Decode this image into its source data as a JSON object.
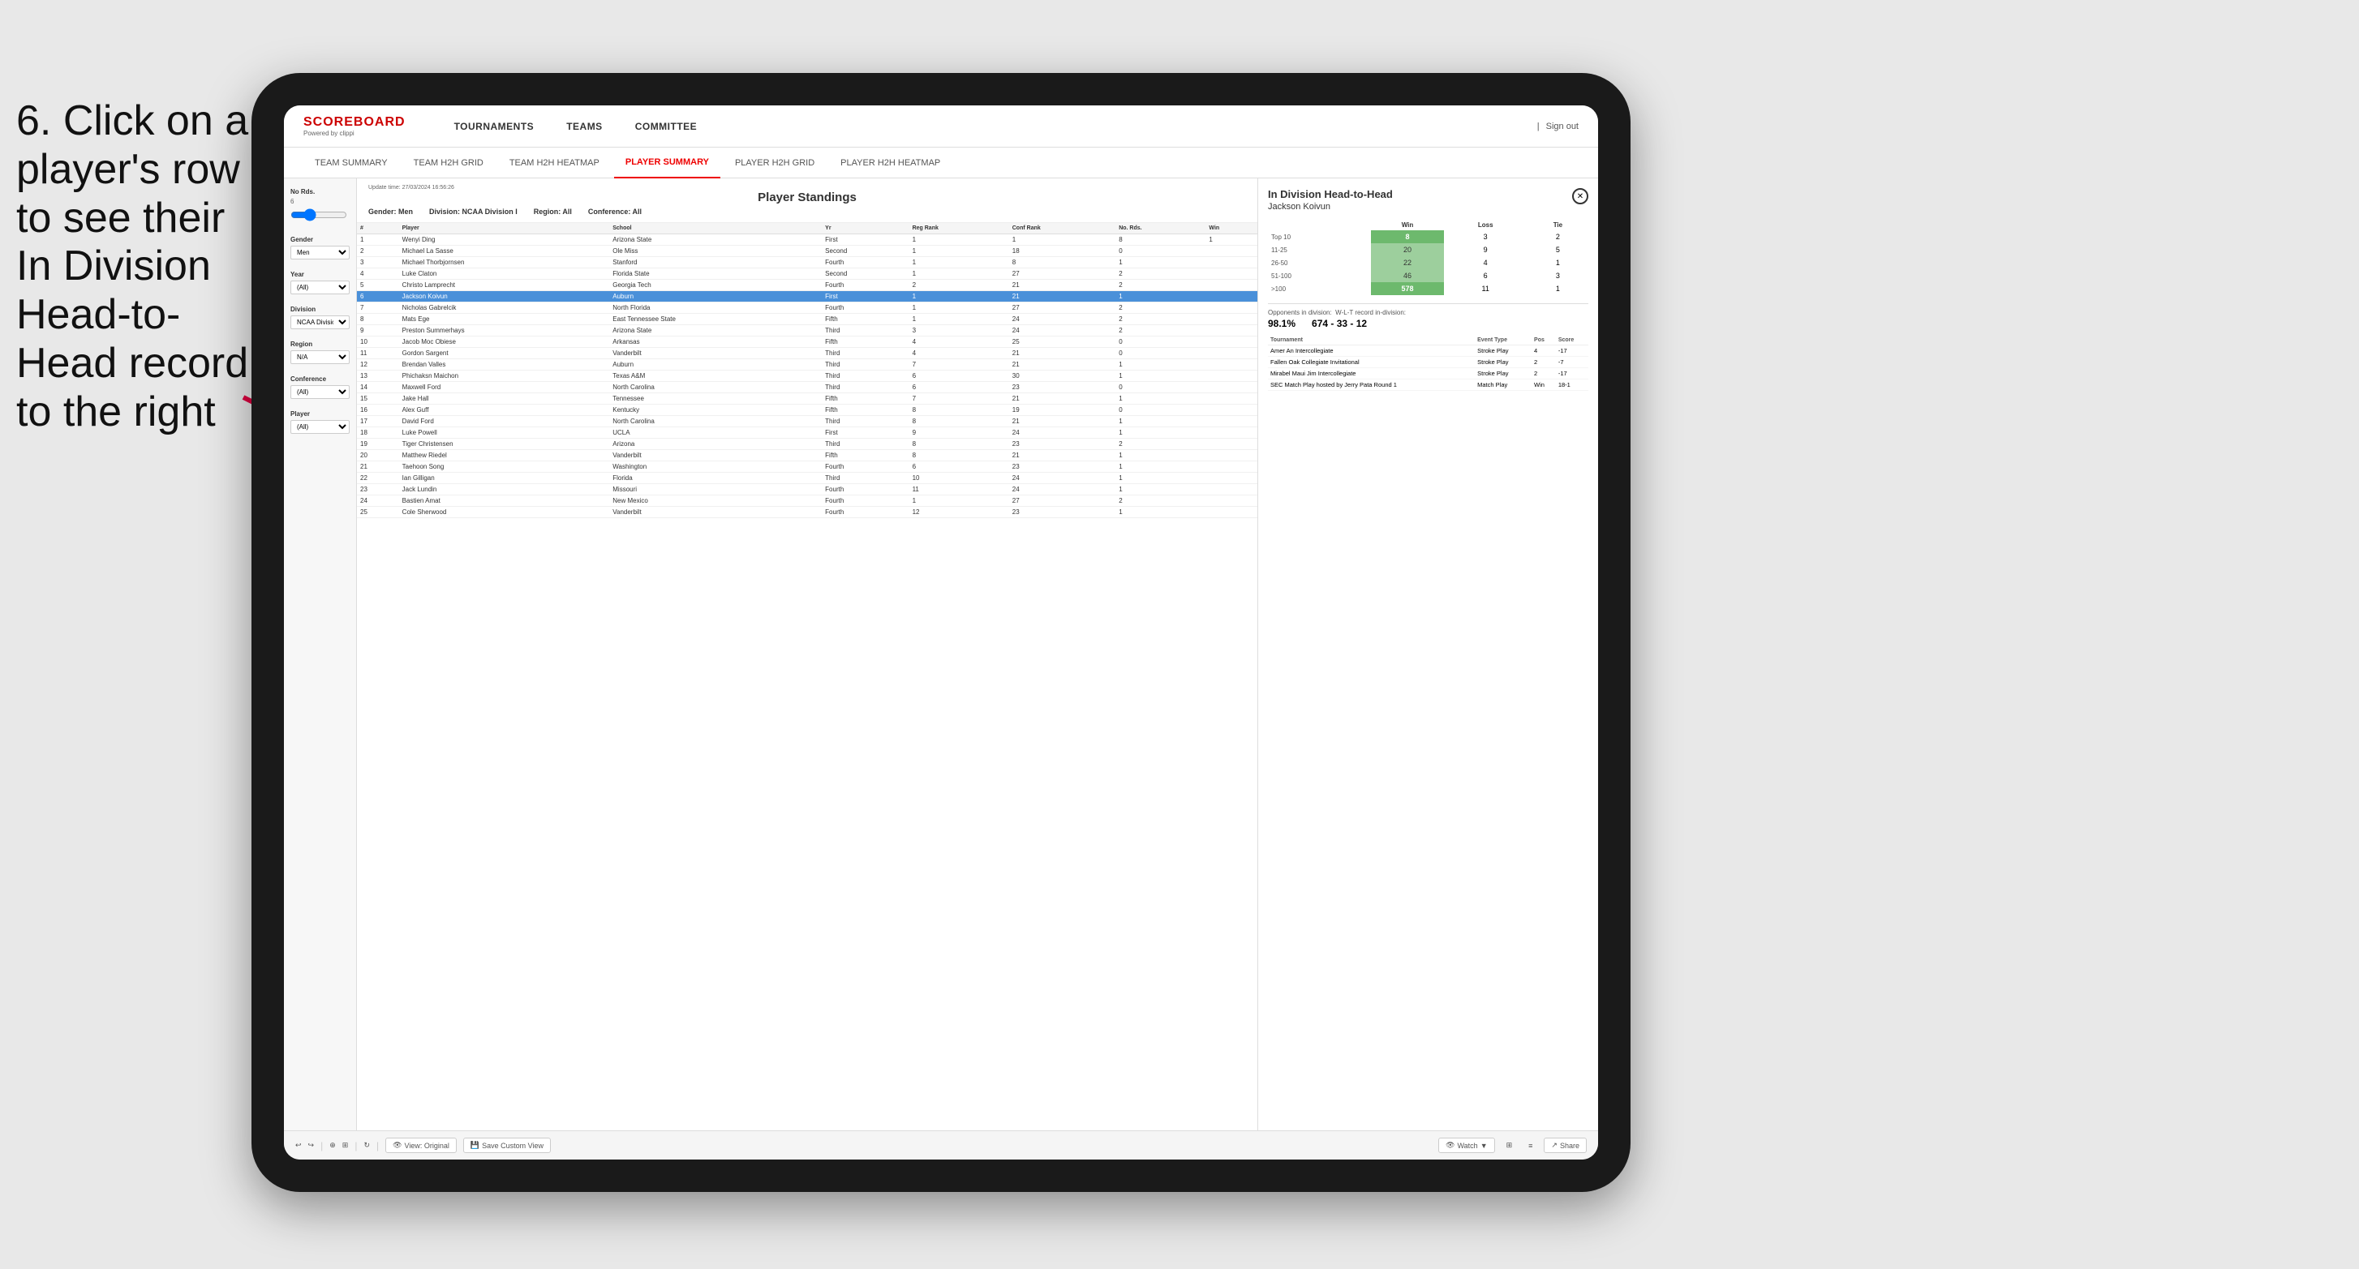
{
  "instruction": {
    "text": "6. Click on a player's row to see their In Division Head-to-Head record to the right"
  },
  "nav": {
    "logo": "SCOREBOARD",
    "logo_sub": "Powered by clippi",
    "items": [
      "TOURNAMENTS",
      "TEAMS",
      "COMMITTEE"
    ],
    "sign_out": "Sign out"
  },
  "sub_nav": {
    "items": [
      "TEAM SUMMARY",
      "TEAM H2H GRID",
      "TEAM H2H HEATMAP",
      "PLAYER SUMMARY",
      "PLAYER H2H GRID",
      "PLAYER H2H HEATMAP"
    ],
    "active": "PLAYER SUMMARY"
  },
  "table": {
    "title": "Player Standings",
    "update_time": "Update time:",
    "update_date": "27/03/2024 16:56:26",
    "filters": {
      "gender": "Gender: Men",
      "division": "Division: NCAA Division I",
      "region": "Region: All",
      "conference": "Conference: All"
    },
    "columns": [
      "#",
      "Player",
      "School",
      "Yr",
      "Reg Rank",
      "Conf Rank",
      "No. Rds.",
      "Win"
    ],
    "rows": [
      {
        "num": 1,
        "player": "Wenyi Ding",
        "school": "Arizona State",
        "yr": "First",
        "reg": 1,
        "conf": 1,
        "rds": 8,
        "win": 1
      },
      {
        "num": 2,
        "player": "Michael La Sasse",
        "school": "Ole Miss",
        "yr": "Second",
        "reg": 1,
        "conf": 18,
        "rds": 0
      },
      {
        "num": 3,
        "player": "Michael Thorbjornsen",
        "school": "Stanford",
        "yr": "Fourth",
        "reg": 1,
        "conf": 8,
        "rds": 1
      },
      {
        "num": 4,
        "player": "Luke Claton",
        "school": "Florida State",
        "yr": "Second",
        "reg": 1,
        "conf": 27,
        "rds": 2
      },
      {
        "num": 5,
        "player": "Christo Lamprecht",
        "school": "Georgia Tech",
        "yr": "Fourth",
        "reg": 2,
        "conf": 21,
        "rds": 2
      },
      {
        "num": 6,
        "player": "Jackson Koivun",
        "school": "Auburn",
        "yr": "First",
        "reg": 1,
        "conf": 21,
        "rds": 1,
        "highlighted": true
      },
      {
        "num": 7,
        "player": "Nicholas Gabrelcik",
        "school": "North Florida",
        "yr": "Fourth",
        "reg": 1,
        "conf": 27,
        "rds": 2
      },
      {
        "num": 8,
        "player": "Mats Ege",
        "school": "East Tennessee State",
        "yr": "Fifth",
        "reg": 1,
        "conf": 24,
        "rds": 2
      },
      {
        "num": 9,
        "player": "Preston Summerhays",
        "school": "Arizona State",
        "yr": "Third",
        "reg": 3,
        "conf": 24,
        "rds": 2
      },
      {
        "num": 10,
        "player": "Jacob Moc Obiese",
        "school": "Arkansas",
        "yr": "Fifth",
        "reg": 4,
        "conf": 25,
        "rds": 0
      },
      {
        "num": 11,
        "player": "Gordon Sargent",
        "school": "Vanderbilt",
        "yr": "Third",
        "reg": 4,
        "conf": 21,
        "rds": 0
      },
      {
        "num": 12,
        "player": "Brendan Valles",
        "school": "Auburn",
        "yr": "Third",
        "reg": 7,
        "conf": 21,
        "rds": 1
      },
      {
        "num": 13,
        "player": "Phichaksn Maichon",
        "school": "Texas A&M",
        "yr": "Third",
        "reg": 6,
        "conf": 30,
        "rds": 1
      },
      {
        "num": 14,
        "player": "Maxwell Ford",
        "school": "North Carolina",
        "yr": "Third",
        "reg": 6,
        "conf": 23,
        "rds": 0
      },
      {
        "num": 15,
        "player": "Jake Hall",
        "school": "Tennessee",
        "yr": "Fifth",
        "reg": 7,
        "conf": 21,
        "rds": 1
      },
      {
        "num": 16,
        "player": "Alex Guff",
        "school": "Kentucky",
        "yr": "Fifth",
        "reg": 8,
        "conf": 19,
        "rds": 0
      },
      {
        "num": 17,
        "player": "David Ford",
        "school": "North Carolina",
        "yr": "Third",
        "reg": 8,
        "conf": 21,
        "rds": 1
      },
      {
        "num": 18,
        "player": "Luke Powell",
        "school": "UCLA",
        "yr": "First",
        "reg": 9,
        "conf": 24,
        "rds": 1
      },
      {
        "num": 19,
        "player": "Tiger Christensen",
        "school": "Arizona",
        "yr": "Third",
        "reg": 8,
        "conf": 23,
        "rds": 2
      },
      {
        "num": 20,
        "player": "Matthew Riedel",
        "school": "Vanderbilt",
        "yr": "Fifth",
        "reg": 8,
        "conf": 21,
        "rds": 1
      },
      {
        "num": 21,
        "player": "Taehoon Song",
        "school": "Washington",
        "yr": "Fourth",
        "reg": 6,
        "conf": 23,
        "rds": 1
      },
      {
        "num": 22,
        "player": "Ian Gilligan",
        "school": "Florida",
        "yr": "Third",
        "reg": 10,
        "conf": 24,
        "rds": 1
      },
      {
        "num": 23,
        "player": "Jack Lundin",
        "school": "Missouri",
        "yr": "Fourth",
        "reg": 11,
        "conf": 24,
        "rds": 1
      },
      {
        "num": 24,
        "player": "Bastien Amat",
        "school": "New Mexico",
        "yr": "Fourth",
        "reg": 1,
        "conf": 27,
        "rds": 2
      },
      {
        "num": 25,
        "player": "Cole Sherwood",
        "school": "Vanderbilt",
        "yr": "Fourth",
        "reg": 12,
        "conf": 23,
        "rds": 1
      }
    ]
  },
  "filters_sidebar": {
    "no_rds_label": "No Rds.",
    "gender_label": "Gender",
    "gender_value": "Men",
    "year_label": "Year",
    "year_value": "(All)",
    "division_label": "Division",
    "division_value": "NCAA Division I",
    "region_label": "Region",
    "region_value": "N/A",
    "conference_label": "Conference",
    "conference_value": "(All)",
    "player_label": "Player",
    "player_value": "(All)"
  },
  "h2h": {
    "title": "In Division Head-to-Head",
    "player": "Jackson Koivun",
    "columns": [
      "Win",
      "Loss",
      "Tie"
    ],
    "rows": [
      {
        "label": "Top 10",
        "win": 8,
        "loss": 3,
        "tie": 2,
        "win_style": "green"
      },
      {
        "label": "11-25",
        "win": 20,
        "loss": 9,
        "tie": 5,
        "win_style": "light-green"
      },
      {
        "label": "26-50",
        "win": 22,
        "loss": 4,
        "tie": 1,
        "win_style": "light-green"
      },
      {
        "label": "51-100",
        "win": 46,
        "loss": 6,
        "tie": 3,
        "win_style": "light-green"
      },
      {
        "label": ">100",
        "win": 578,
        "loss": 11,
        "tie": 1,
        "win_style": "green"
      }
    ],
    "opponents_label": "Opponents in division:",
    "wlt_label": "W-L-T record in-division:",
    "opponents_pct": "98.1%",
    "wlt_record": "674 - 33 - 12",
    "tournament_cols": [
      "Tournament",
      "Event Type",
      "Pos",
      "Score"
    ],
    "tournaments": [
      {
        "name": "Amer An Intercollegiate",
        "type": "Stroke Play",
        "pos": 4,
        "score": "-17"
      },
      {
        "name": "Fallen Oak Collegiate Invitational",
        "type": "Stroke Play",
        "pos": 2,
        "score": "-7"
      },
      {
        "name": "Mirabel Maui Jim Intercollegiate",
        "type": "Stroke Play",
        "pos": 2,
        "score": "-17"
      },
      {
        "name": "SEC Match Play hosted by Jerry Pata Round 1",
        "type": "Match Play",
        "pos": "Win",
        "score": "18-1"
      }
    ]
  },
  "toolbar": {
    "view_original": "View: Original",
    "save_custom": "Save Custom View",
    "watch": "Watch",
    "share": "Share"
  }
}
